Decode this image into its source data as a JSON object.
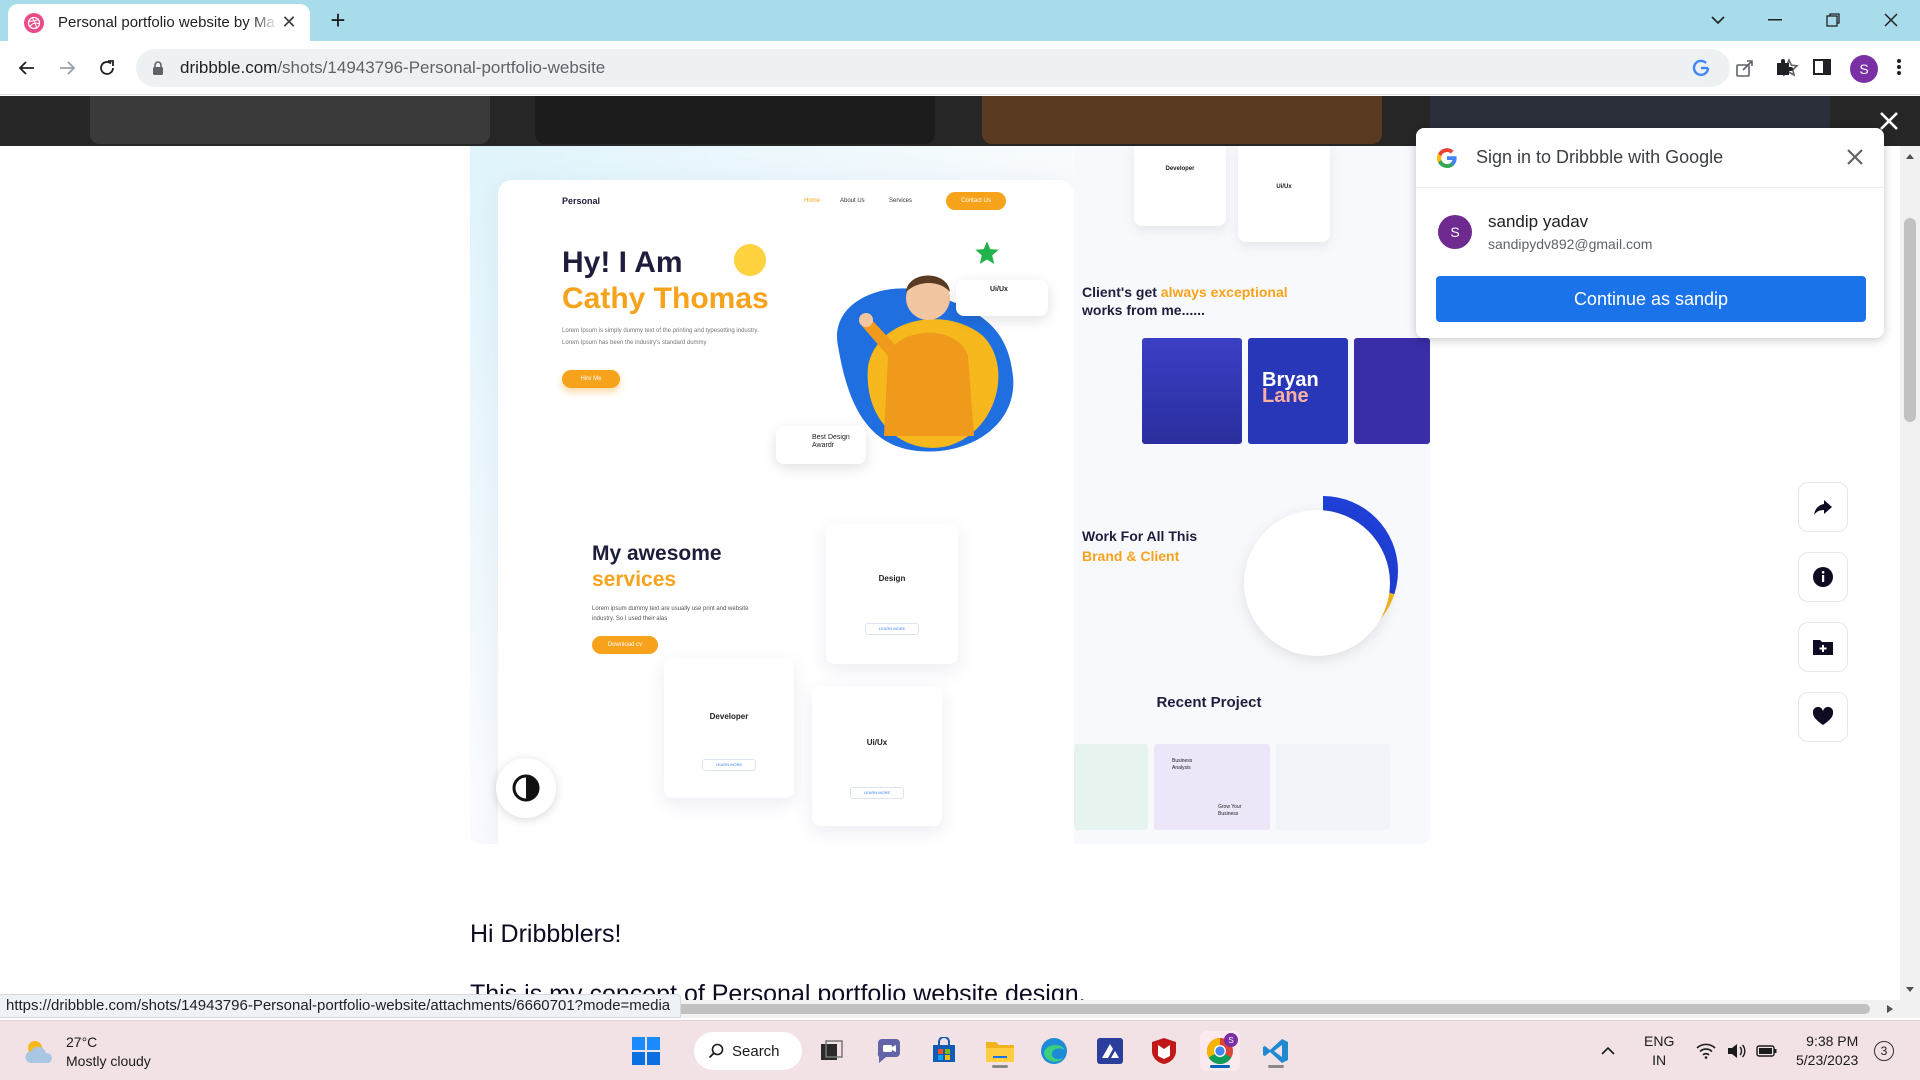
{
  "browser": {
    "tab_title": "Personal portfolio website by Ma",
    "url_domain": "dribbble.com",
    "url_path": "/shots/14943796-Personal-portfolio-website",
    "status_url": "https://dribbble.com/shots/14943796-Personal-portfolio-website/attachments/6660701?mode=media",
    "profile_initial": "S"
  },
  "google_signin": {
    "title": "Sign in to Dribbble with Google",
    "account_initial": "S",
    "account_name": "sandip yadav",
    "account_email": "sandipydv892@gmail.com",
    "continue_label": "Continue as sandip"
  },
  "shot_mockup": {
    "brand": "Personal",
    "nav": [
      "Home",
      "About Us",
      "Services"
    ],
    "nav_cta": "Contact Us",
    "hero_line1": "Hy! I Am",
    "hero_name": "Cathy Thomas",
    "hero_text_1": "Lorem Ipsum is simply dummy text of the printing and typesetting industry.",
    "hero_text_2": "Lorem Ipsum has been the industry's standard dummy",
    "hero_cta": "Hire Me",
    "badge_uiux": "Ui/Ux",
    "badge_award_1": "Best Design",
    "badge_award_2": "Awardr",
    "services_title_1": "My awesome",
    "services_title_2": "services",
    "services_text_1": "Lorem ipsum dummy text are usually use print and website",
    "services_text_2": "industry. So I used their alas",
    "services_cta": "Download cv",
    "cards": [
      {
        "title": "Design",
        "cta": "LEARN MORE"
      },
      {
        "title": "Developer",
        "cta": "LEARN MORE"
      },
      {
        "title": "Ui/Ux",
        "cta": "LEARN MORE"
      }
    ],
    "right_top_cards": [
      "Developer",
      "Ui/Ux"
    ],
    "clients_title_1": "Client's get ",
    "clients_highlight": "always exceptional",
    "clients_title_2": "works from me......",
    "bryan_1": "Bryan",
    "bryan_2": "Lane",
    "work_title_1": "Work For All This",
    "work_title_2": "Brand & Client",
    "recent_title": "Recent Project",
    "recent_card_1": "Business Analysis",
    "recent_card_2": "Grow Your Business"
  },
  "description": {
    "greeting": "Hi Dribbblers!",
    "line": "This is my concept of Personal portfolio website design."
  },
  "taskbar": {
    "temperature": "27°C",
    "weather": "Mostly cloudy",
    "search_label": "Search",
    "lang_1": "ENG",
    "lang_2": "IN",
    "time": "9:38 PM",
    "date": "5/23/2023",
    "notification_count": "3"
  },
  "colors": {
    "tabbar": "#a8dceb",
    "accent_orange": "#f7a21b",
    "google_blue": "#1a73e8",
    "dribbble_pink": "#ea4c89",
    "taskbar": "#f3e2e5"
  }
}
